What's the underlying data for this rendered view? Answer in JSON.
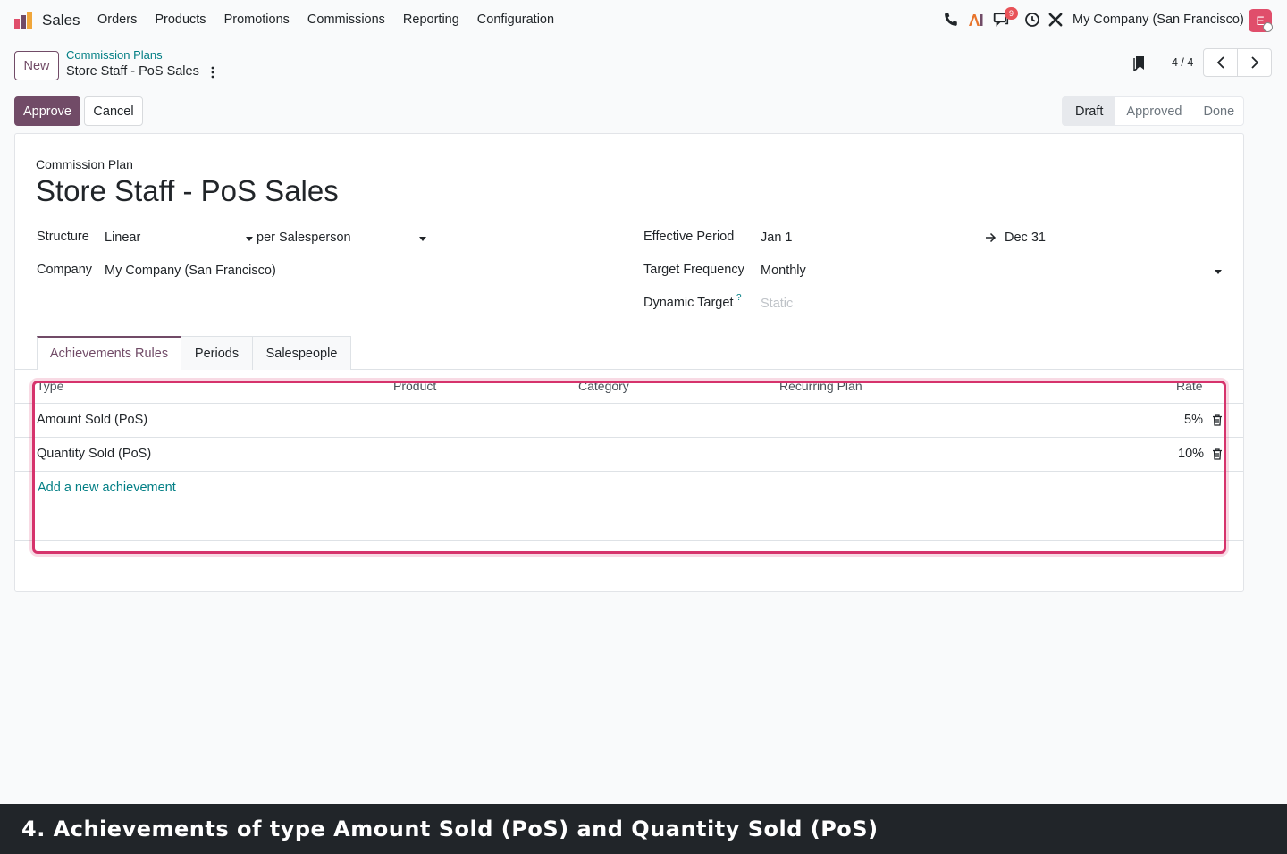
{
  "navbar": {
    "app_name": "Sales",
    "menu": [
      "Orders",
      "Products",
      "Promotions",
      "Commissions",
      "Reporting",
      "Configuration"
    ],
    "messages_badge": "9",
    "company": "My Company (San Francisco)",
    "avatar_initial": "E",
    "icons": [
      "phone-icon",
      "ai-icon",
      "messages-icon",
      "clock-icon",
      "tools-icon"
    ]
  },
  "control_panel": {
    "new_label": "New",
    "breadcrumb_parent": "Commission Plans",
    "breadcrumb_current": "Store Staff - PoS Sales",
    "pager": "4 / 4"
  },
  "actions": {
    "approve_label": "Approve",
    "cancel_label": "Cancel"
  },
  "statusbar": {
    "stages": [
      "Draft",
      "Approved",
      "Done"
    ],
    "active": "Draft"
  },
  "form": {
    "subtitle": "Commission Plan",
    "title": "Store Staff - PoS Sales",
    "structure_label": "Structure",
    "structure_value": "Linear",
    "structure_per": "per Salesperson",
    "company_label": "Company",
    "company_value": "My Company (San Francisco)",
    "period_label": "Effective Period",
    "period_start": "Jan 1",
    "period_end": "Dec 31",
    "frequency_label": "Target Frequency",
    "frequency_value": "Monthly",
    "dynamic_label": "Dynamic Target",
    "dynamic_help": "?",
    "dynamic_value": "Static"
  },
  "tabs": [
    "Achievements Rules",
    "Periods",
    "Salespeople"
  ],
  "table": {
    "headers": [
      "Type",
      "Product",
      "Category",
      "Recurring Plan",
      "Rate"
    ],
    "rows": [
      {
        "type": "Amount Sold (PoS)",
        "rate": "5%"
      },
      {
        "type": "Quantity Sold (PoS)",
        "rate": "10%"
      }
    ],
    "add_line": "Add a new achievement"
  },
  "caption": "4. Achievements of type Amount Sold (PoS) and Quantity Sold (PoS)",
  "colors": {
    "brand": "#714b67",
    "link": "#017e84",
    "highlight": "#d6336c",
    "badge": "#e85258"
  }
}
